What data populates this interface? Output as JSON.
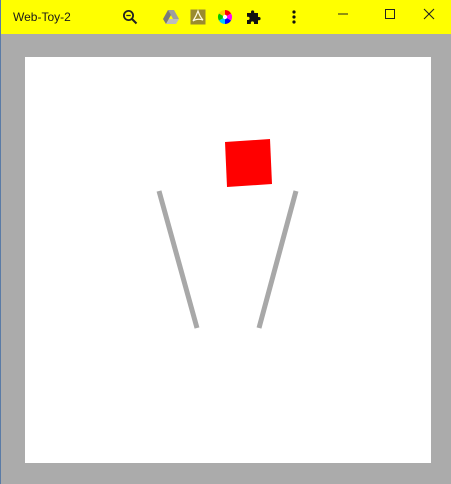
{
  "window": {
    "title": "Web-Toy-2"
  },
  "toolbar": {
    "icons": [
      "zoom-icon",
      "drive-icon",
      "pdf-icon",
      "color-wheel-icon",
      "extension-puzzle-icon",
      "more-vert-icon"
    ]
  },
  "window_controls": [
    "minimize",
    "maximize",
    "close"
  ],
  "colors": {
    "titlebar": "#ffff00",
    "frame": "#ababab",
    "canvas": "#ffffff",
    "box": "#ff0000",
    "stick": "#a8a8a8"
  },
  "scene": {
    "objects": [
      "red-box",
      "left-stick",
      "right-stick"
    ]
  }
}
